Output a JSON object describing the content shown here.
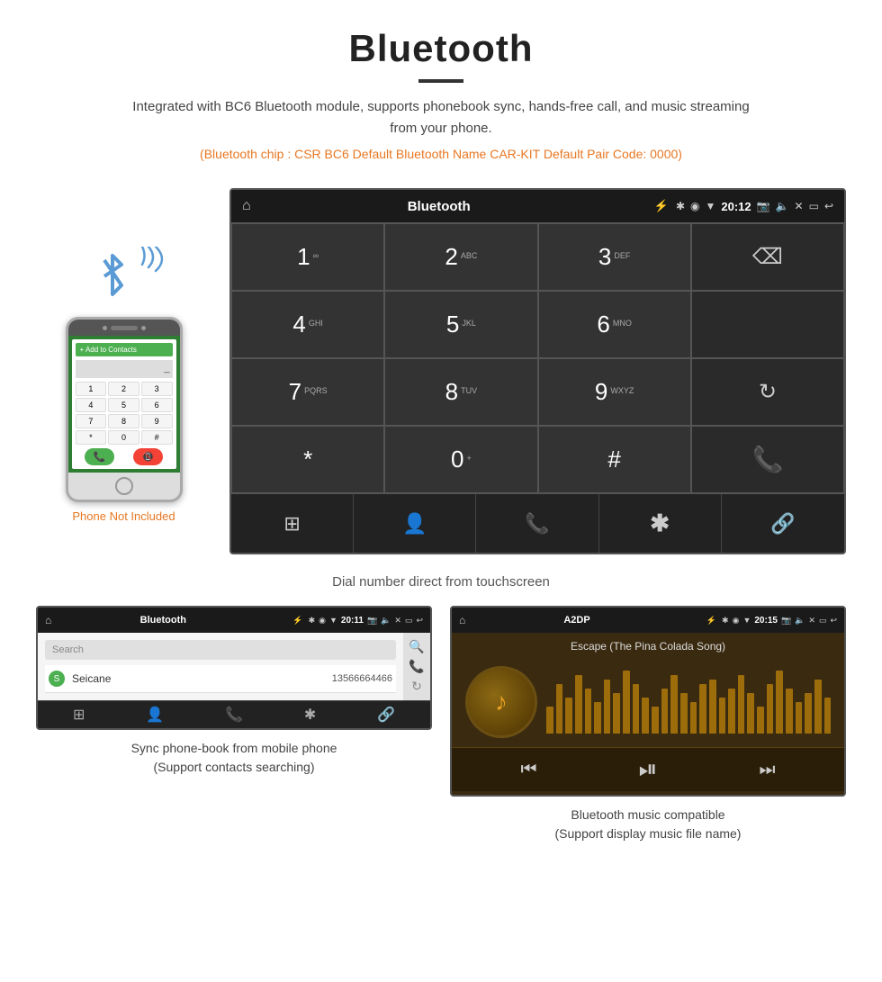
{
  "header": {
    "title": "Bluetooth",
    "subtitle": "Integrated with BC6 Bluetooth module, supports phonebook sync, hands-free call, and music streaming from your phone.",
    "info_line": "(Bluetooth chip : CSR BC6    Default Bluetooth Name CAR-KIT    Default Pair Code: 0000)"
  },
  "phone_label": "Phone Not Included",
  "main_screen": {
    "title": "Bluetooth",
    "time": "20:12",
    "keys": [
      {
        "num": "1",
        "sub": "∞"
      },
      {
        "num": "2",
        "sub": "ABC"
      },
      {
        "num": "3",
        "sub": "DEF"
      },
      {
        "num": "",
        "sub": ""
      },
      {
        "num": "4",
        "sub": "GHI"
      },
      {
        "num": "5",
        "sub": "JKL"
      },
      {
        "num": "6",
        "sub": "MNO"
      },
      {
        "num": "",
        "sub": ""
      },
      {
        "num": "7",
        "sub": "PQRS"
      },
      {
        "num": "8",
        "sub": "TUV"
      },
      {
        "num": "9",
        "sub": "WXYZ"
      },
      {
        "num": "↻",
        "sub": ""
      },
      {
        "num": "*",
        "sub": ""
      },
      {
        "num": "0",
        "sub": "+"
      },
      {
        "num": "#",
        "sub": ""
      },
      {
        "num": "call",
        "sub": ""
      },
      {
        "num": "",
        "sub": ""
      },
      {
        "num": "",
        "sub": ""
      }
    ],
    "bottom_actions": [
      "grid",
      "person",
      "phone",
      "bluetooth",
      "link"
    ]
  },
  "caption": "Dial number direct from touchscreen",
  "phonebook_screen": {
    "title": "Bluetooth",
    "time": "20:11",
    "search_placeholder": "Search",
    "contact": {
      "letter": "S",
      "name": "Seicane",
      "number": "13566664466"
    },
    "caption_line1": "Sync phone-book from mobile phone",
    "caption_line2": "(Support contacts searching)"
  },
  "music_screen": {
    "title": "A2DP",
    "time": "20:15",
    "song_title": "Escape (The Pina Colada Song)",
    "viz_heights": [
      30,
      55,
      40,
      65,
      50,
      35,
      60,
      45,
      70,
      55,
      40,
      30,
      50,
      65,
      45,
      35,
      55,
      60,
      40,
      50,
      65,
      45,
      30,
      55,
      70,
      50,
      35,
      45,
      60,
      40
    ],
    "caption_line1": "Bluetooth music compatible",
    "caption_line2": "(Support display music file name)"
  },
  "icons": {
    "home": "⌂",
    "bluetooth": "✱",
    "backspace": "⌫",
    "call_green": "📞",
    "end_call": "📵",
    "grid": "⊞",
    "person": "👤",
    "phone_icon": "📞",
    "bt_icon": "✱",
    "link": "🔗",
    "search": "🔍",
    "reload": "↻",
    "music_note": "♪",
    "prev": "⏮",
    "play_pause": "⏯",
    "next": "⏭"
  }
}
